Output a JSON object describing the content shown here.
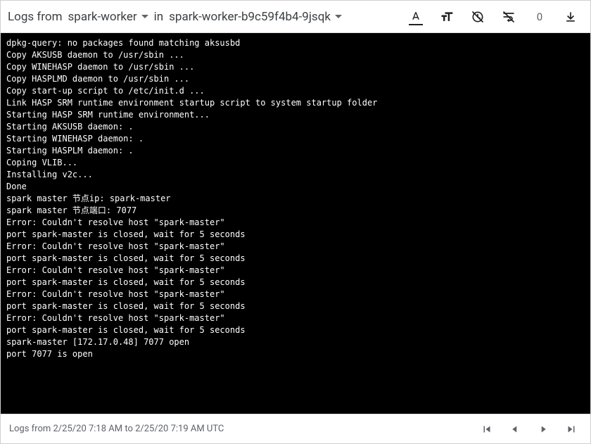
{
  "header": {
    "prefix": "Logs from",
    "selector1": "spark-worker",
    "conj": "in",
    "selector2": "spark-worker-b9c59f4b4-9jsqk",
    "new_count": "0"
  },
  "log_lines": [
    "dpkg-query: no packages found matching aksusbd",
    "Copy AKSUSB daemon to /usr/sbin ...",
    "Copy WINEHASP daemon to /usr/sbin ...",
    "Copy HASPLMD daemon to /usr/sbin ...",
    "Copy start-up script to /etc/init.d ...",
    "Link HASP SRM runtime environment startup script to system startup folder",
    "Starting HASP SRM runtime environment...",
    "Starting AKSUSB daemon: .",
    "Starting WINEHASP daemon: .",
    "Starting HASPLM daemon: .",
    "Coping VLIB...",
    "Installing v2c...",
    "Done",
    "spark master 节点ip: spark-master",
    "spark master 节点端口: 7077",
    "Error: Couldn't resolve host \"spark-master\"",
    "port spark-master is closed, wait for 5 seconds",
    "Error: Couldn't resolve host \"spark-master\"",
    "port spark-master is closed, wait for 5 seconds",
    "Error: Couldn't resolve host \"spark-master\"",
    "port spark-master is closed, wait for 5 seconds",
    "Error: Couldn't resolve host \"spark-master\"",
    "port spark-master is closed, wait for 5 seconds",
    "Error: Couldn't resolve host \"spark-master\"",
    "port spark-master is closed, wait for 5 seconds",
    "spark-master [172.17.0.48] 7077 open",
    "port 7077 is open"
  ],
  "footer": {
    "range_text": "Logs from 2/25/20 7:18 AM to 2/25/20 7:19 AM UTC"
  }
}
